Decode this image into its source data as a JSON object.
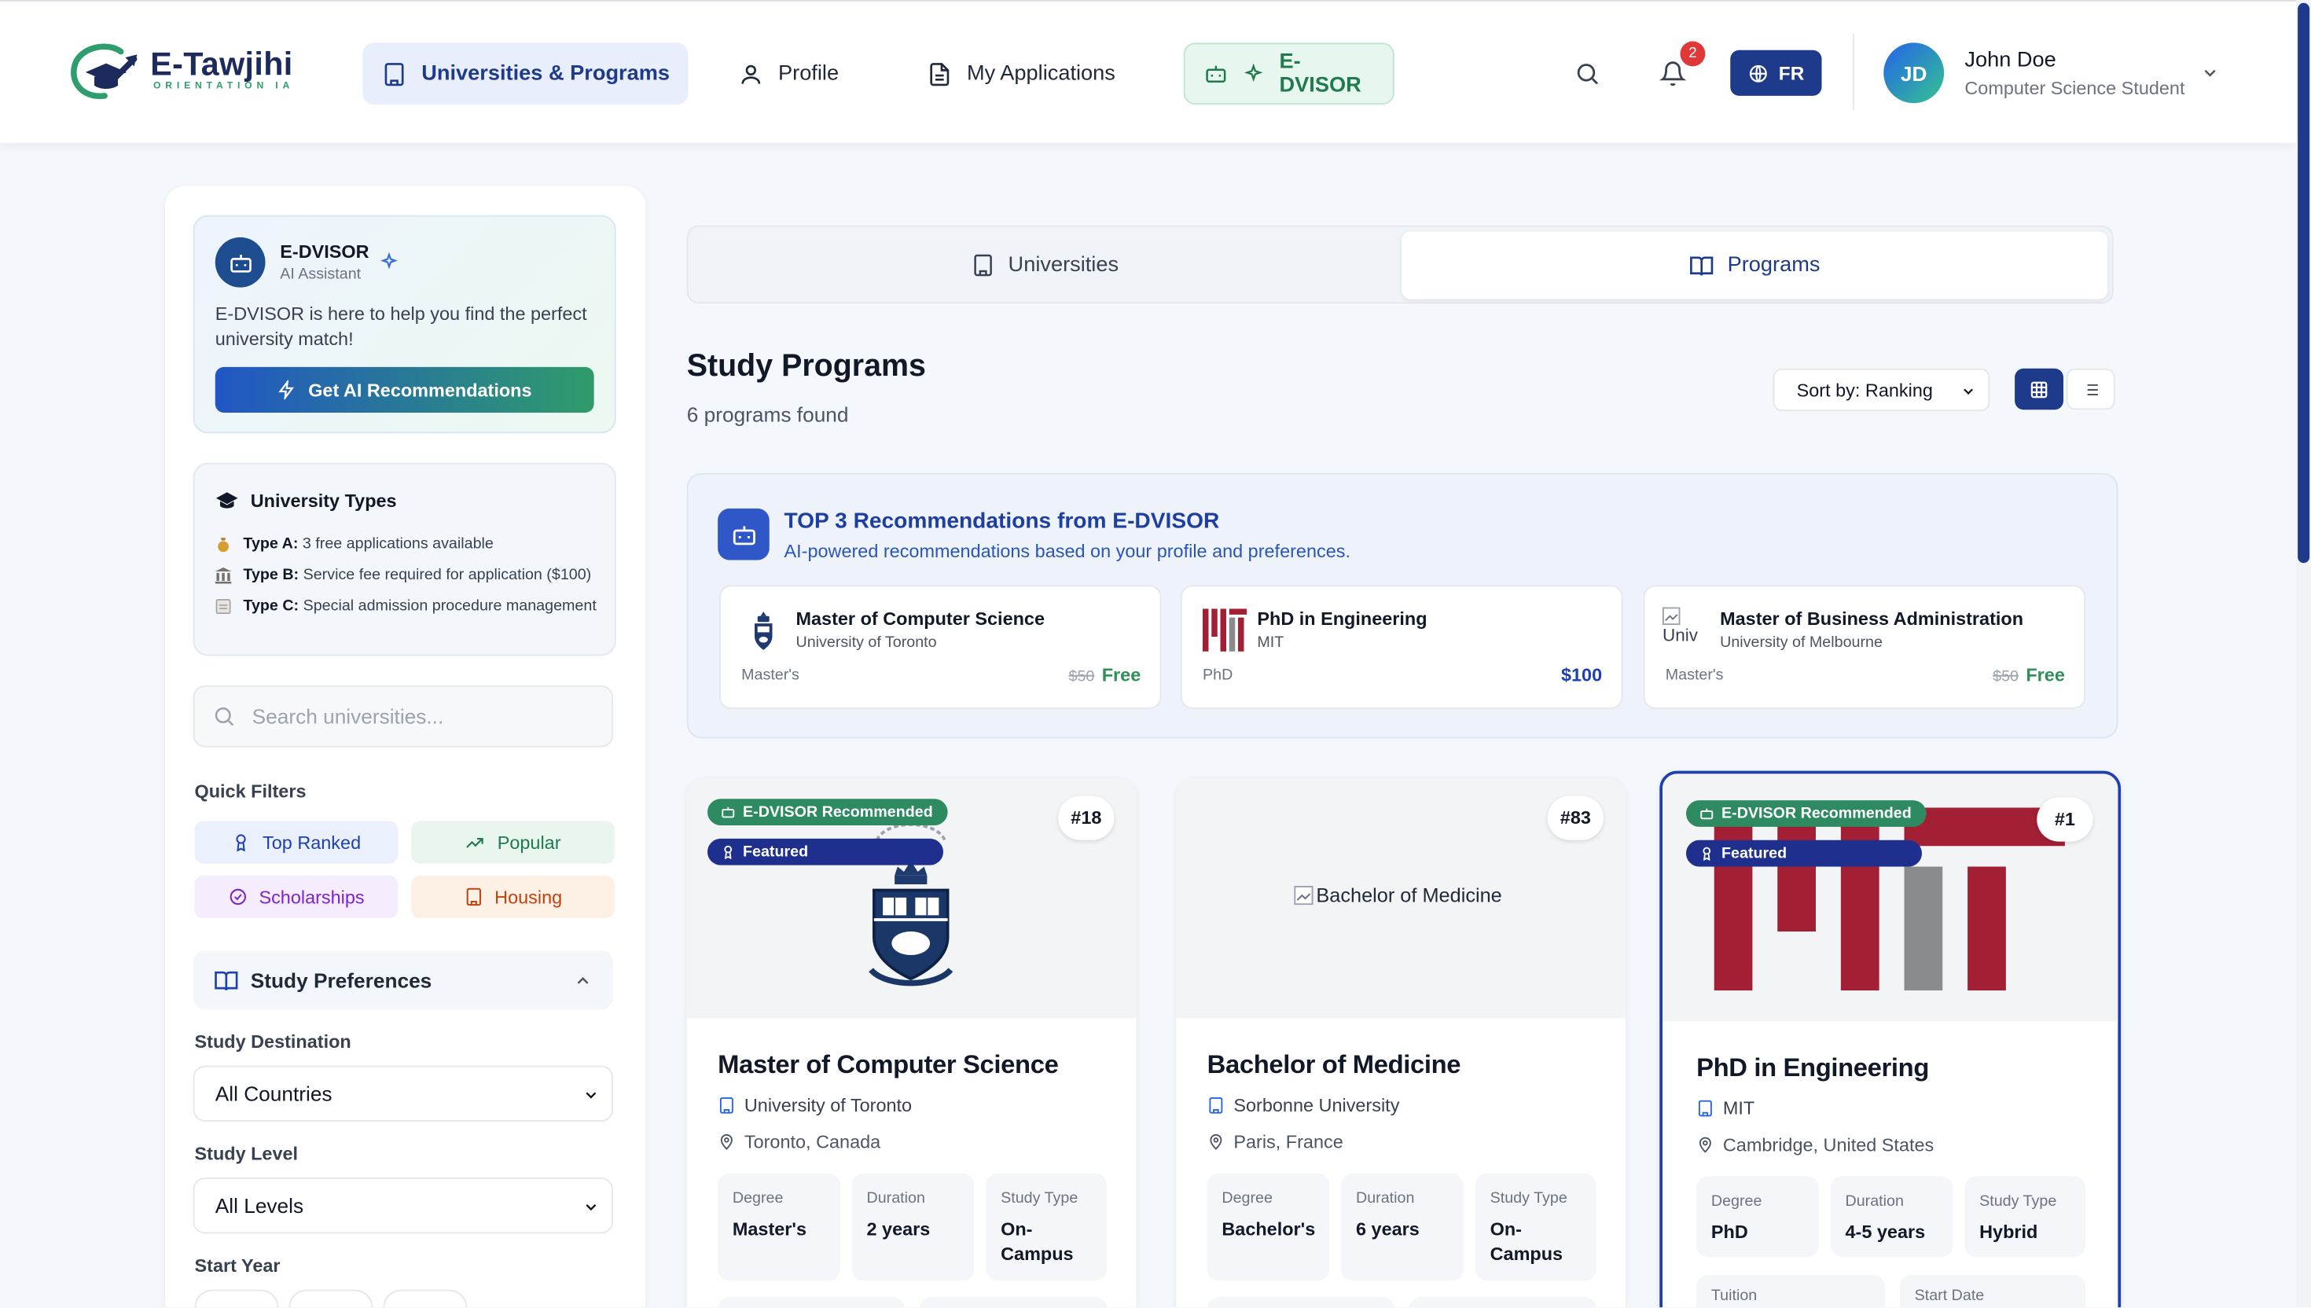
{
  "app": {
    "logo_title": "E-Tawjihi",
    "logo_sub": "ORIENTATION IA",
    "brand_colors": {
      "primary": "#1e3a8a",
      "accent_green": "#2f9e6e",
      "notification": "#e03838"
    }
  },
  "header": {
    "nav": [
      {
        "label": "Universities & Programs",
        "icon": "building-icon",
        "active": true
      },
      {
        "label": "Profile",
        "icon": "user-icon"
      },
      {
        "label": "My Applications",
        "icon": "document-icon"
      },
      {
        "label": "E-DVISOR",
        "icon": "robot-icon"
      }
    ],
    "notification_count": "2",
    "language": "FR",
    "user": {
      "initials": "JD",
      "name": "John Doe",
      "role": "Computer Science Student"
    }
  },
  "sidebar": {
    "advisor": {
      "name": "E-DVISOR",
      "role": "AI Assistant",
      "message": "E-DVISOR is here to help you find the perfect university match!",
      "button": "Get AI Recommendations"
    },
    "types": {
      "title": "University Types",
      "items": [
        {
          "label": "Type A:",
          "text": "3 free applications available",
          "icon": "money-bag-icon"
        },
        {
          "label": "Type B:",
          "text": "Service fee required for application ($100)",
          "icon": "bank-icon"
        },
        {
          "label": "Type C:",
          "text": "Special admission procedure management",
          "icon": "clipboard-icon"
        }
      ]
    },
    "search_placeholder": "Search universities...",
    "quick_filters_title": "Quick Filters",
    "quick_filters": [
      {
        "label": "Top Ranked",
        "icon": "award-icon",
        "color": "#1e40af",
        "bg": "#eaf1fc"
      },
      {
        "label": "Popular",
        "icon": "trending-up-icon",
        "color": "#1f7a4d",
        "bg": "#e8f6ee"
      },
      {
        "label": "Scholarships",
        "icon": "check-circle-icon",
        "color": "#7e22ce",
        "bg": "#f5edfd"
      },
      {
        "label": "Housing",
        "icon": "building-icon",
        "color": "#c2410c",
        "bg": "#fdf1e6"
      }
    ],
    "preferences": {
      "title": "Study Preferences",
      "destination_label": "Study Destination",
      "destination_value": "All Countries",
      "level_label": "Study Level",
      "level_value": "All Levels",
      "start_year_label": "Start Year"
    }
  },
  "main": {
    "tabs": [
      {
        "label": "Universities",
        "active": false
      },
      {
        "label": "Programs",
        "active": true
      }
    ],
    "title": "Study Programs",
    "count": "6 programs found",
    "sort_label": "Sort by: Ranking",
    "view_mode": "grid",
    "recommendations": {
      "title": "TOP 3 Recommendations from E-DVISOR",
      "subtitle": "AI-powered recommendations based on your profile and preferences.",
      "items": [
        {
          "name": "Master of Computer Science",
          "university": "University of Toronto",
          "degree": "Master's",
          "old_price": "$50",
          "price": "Free"
        },
        {
          "name": "PhD in Engineering",
          "university": "MIT",
          "degree": "PhD",
          "old_price": "",
          "price": "$100"
        },
        {
          "name": "Master of Business Administration",
          "university": "University of Melbourne",
          "degree": "Master's",
          "old_price": "$50",
          "price": "Free",
          "logo_alt": "Univ"
        }
      ]
    },
    "programs": [
      {
        "name": "Master of Computer Science",
        "university": "University of Toronto",
        "location": "Toronto, Canada",
        "rank": "#18",
        "recommended": "E-DVISOR Recommended",
        "featured": "Featured",
        "degree_label": "Degree",
        "degree": "Master's",
        "duration_label": "Duration",
        "duration": "2 years",
        "type_label": "Study Type",
        "type": "On-Campus"
      },
      {
        "name": "Bachelor of Medicine",
        "university": "Sorbonne University",
        "location": "Paris, France",
        "rank": "#83",
        "image_alt": "Bachelor of Medicine",
        "degree_label": "Degree",
        "degree": "Bachelor's",
        "duration_label": "Duration",
        "duration": "6 years",
        "type_label": "Study Type",
        "type": "On-Campus"
      },
      {
        "name": "PhD in Engineering",
        "university": "MIT",
        "location": "Cambridge, United States",
        "rank": "#1",
        "recommended": "E-DVISOR Recommended",
        "featured": "Featured",
        "degree_label": "Degree",
        "degree": "PhD",
        "duration_label": "Duration",
        "duration": "4-5 years",
        "type_label": "Study Type",
        "type": "Hybrid",
        "tuition_label": "Tuition",
        "start_label": "Start Date"
      }
    ]
  }
}
